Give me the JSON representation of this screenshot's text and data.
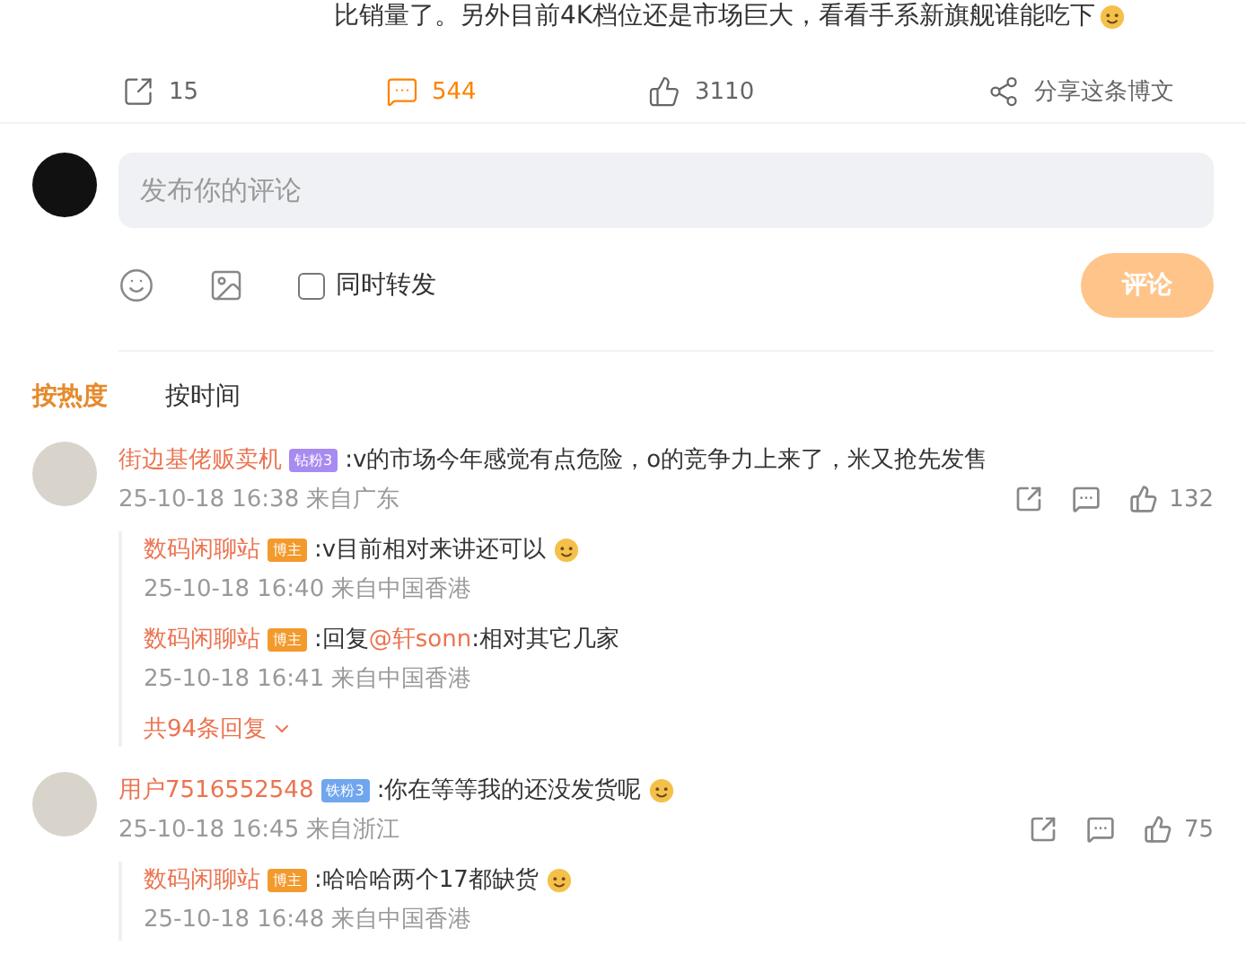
{
  "post_text": "比销量了。另外目前4K档位还是市场巨大，看看手系新旗舰谁能吃下",
  "post_emoji": true,
  "post_actions": [
    {
      "kind": "repost",
      "count": "15",
      "selected": false
    },
    {
      "kind": "comment",
      "count": "544",
      "selected": true
    },
    {
      "kind": "like",
      "count": "3110",
      "selected": false
    },
    {
      "kind": "share",
      "count": "分享这条博文",
      "selected": false
    }
  ],
  "composer": {
    "placeholder": "发布你的评论",
    "repost_option": {
      "label": "同时转发",
      "checked": false
    },
    "submit": "评论"
  },
  "sort_tabs": [
    {
      "label": "按热度",
      "selected": true
    },
    {
      "label": "按时间",
      "selected": false
    }
  ],
  "comments": [
    {
      "user": "街边基佬贩卖机",
      "badge": {
        "label": "钻粉3",
        "kind": "diamond"
      },
      "text": [
        {
          "kind": "plain",
          "value": ":v的市场今年感觉有点危险，o的竞争力上来了，米又抢先发售"
        }
      ],
      "emoji": false,
      "time": "25-10-18 16:38",
      "location": "来自广东",
      "likes": "132",
      "replies": [
        {
          "user": "数码闲聊站",
          "badge": {
            "label": "博主",
            "kind": "author"
          },
          "text": [
            {
              "kind": "plain",
              "value": ":v目前相对来讲还可以"
            }
          ],
          "emoji": true,
          "time": "25-10-18 16:40",
          "location": "来自中国香港"
        },
        {
          "user": "数码闲聊站",
          "badge": {
            "label": "博主",
            "kind": "author"
          },
          "text": [
            {
              "kind": "plain",
              "value": ":回复"
            },
            {
              "kind": "mention",
              "value": "@轩sonn"
            },
            {
              "kind": "plain",
              "value": ":相对其它几家"
            }
          ],
          "emoji": false,
          "time": "25-10-18 16:41",
          "location": "来自中国香港"
        }
      ],
      "more_replies": "共94条回复"
    },
    {
      "user": "用户7516552548",
      "badge": {
        "label": "铁粉3",
        "kind": "iron"
      },
      "text": [
        {
          "kind": "plain",
          "value": ":你在等等我的还没发货呢"
        }
      ],
      "emoji": true,
      "time": "25-10-18 16:45",
      "location": "来自浙江",
      "likes": "75",
      "replies": [
        {
          "user": "数码闲聊站",
          "badge": {
            "label": "博主",
            "kind": "author"
          },
          "text": [
            {
              "kind": "plain",
              "value": ":哈哈哈两个17都缺货"
            }
          ],
          "emoji": true,
          "time": "25-10-18 16:48",
          "location": "来自中国香港"
        }
      ]
    }
  ]
}
